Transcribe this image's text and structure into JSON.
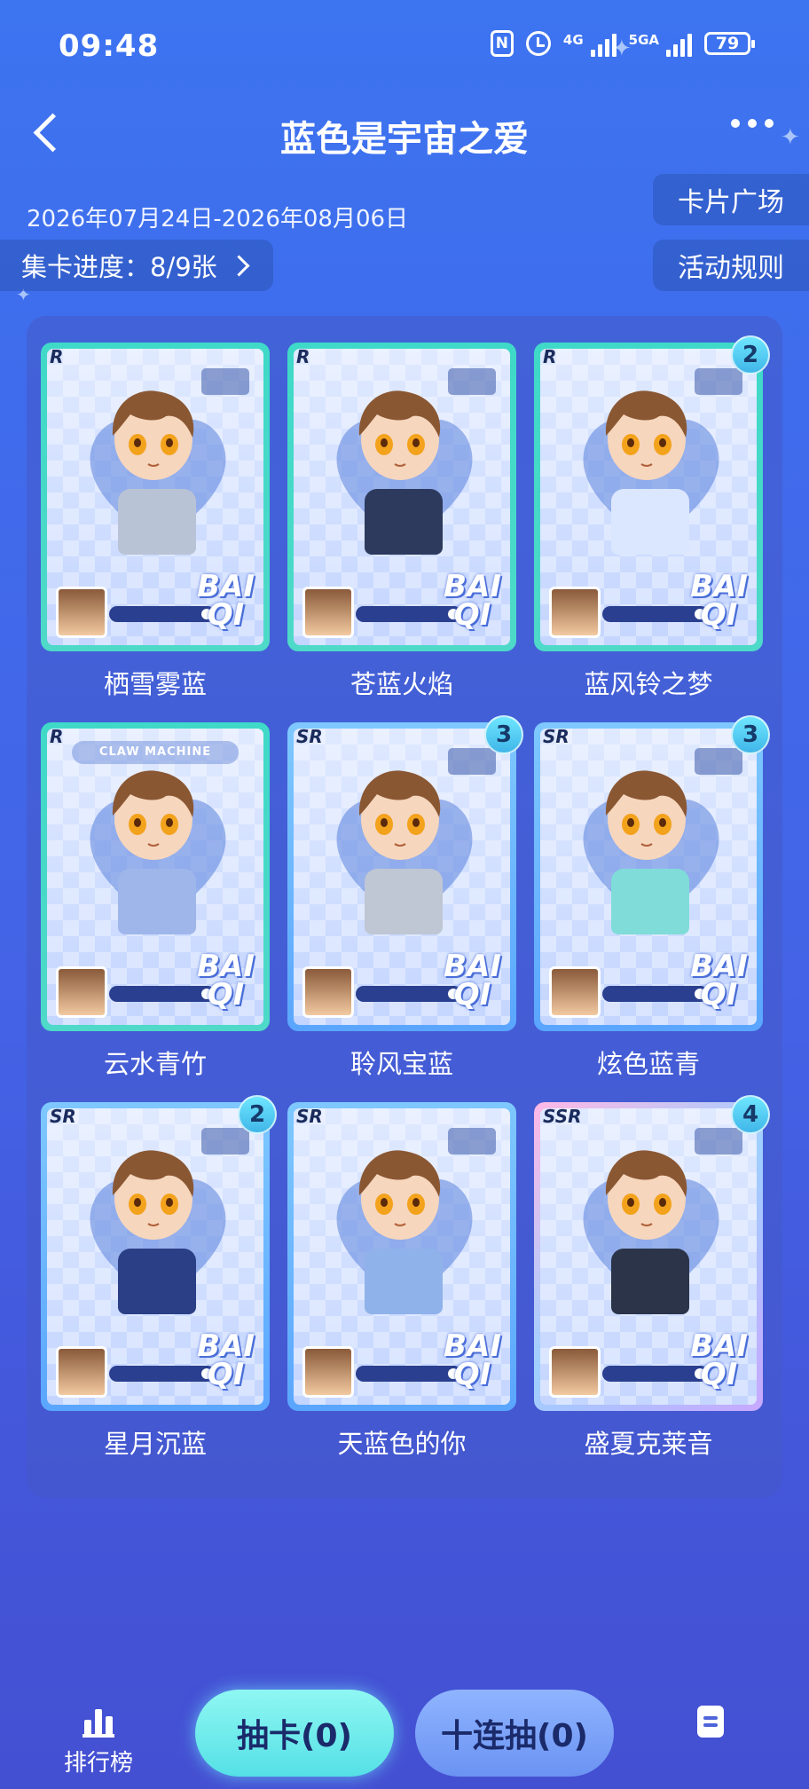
{
  "status_bar": {
    "time": "09:48",
    "nfc": "N",
    "net1": "4G",
    "net2": "5GA",
    "battery": "79"
  },
  "header": {
    "title": "蓝色是宇宙之爱"
  },
  "event": {
    "dates": "2026年07月24日-2026年08月06日",
    "progress_label": "集卡进度：8/9张",
    "card_square": "卡片广场",
    "rules": "活动规则"
  },
  "cards": [
    {
      "rarity": "R",
      "name": "栖雪雾蓝",
      "count": "",
      "theme": "#3fd9c8"
    },
    {
      "rarity": "R",
      "name": "苍蓝火焰",
      "count": "",
      "theme": "#3fd9c8"
    },
    {
      "rarity": "R",
      "name": "蓝风铃之梦",
      "count": "2",
      "theme": "#3fd9c8"
    },
    {
      "rarity": "R",
      "name": "云水青竹",
      "count": "",
      "theme": "#3fd9c8",
      "label": "CLAW MACHINE"
    },
    {
      "rarity": "SR",
      "name": "聆风宝蓝",
      "count": "3",
      "theme": "#6fb8ff"
    },
    {
      "rarity": "SR",
      "name": "炫色蓝青",
      "count": "3",
      "theme": "#6fb8ff"
    },
    {
      "rarity": "SR",
      "name": "星月沉蓝",
      "count": "2",
      "theme": "#6fb8ff"
    },
    {
      "rarity": "SR",
      "name": "天蓝色的你",
      "count": "",
      "theme": "#6fb8ff"
    },
    {
      "rarity": "SSR",
      "name": "盛夏克莱音",
      "count": "4",
      "theme": "#c8a8ff"
    }
  ],
  "card_logo": [
    "BAI",
    "QI"
  ],
  "bottom": {
    "rank_label": "排行榜",
    "draw_label": "抽卡(0)",
    "ten_draw_label": "十连抽(0)"
  },
  "icons": [
    "back-icon",
    "more-icon",
    "chevron-right-icon",
    "ranking-icon",
    "record-icon",
    "nfc-icon",
    "alarm-icon",
    "signal-icon",
    "battery-icon"
  ]
}
